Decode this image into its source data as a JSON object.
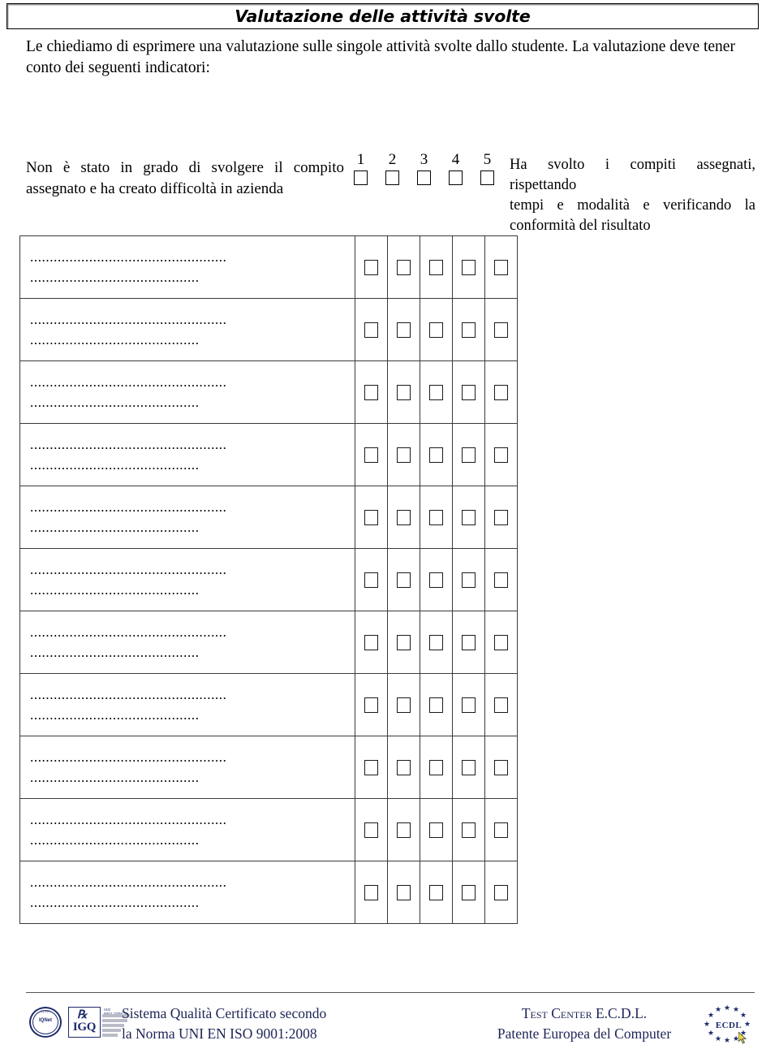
{
  "document": {
    "title": "Valutazione delle attività svolte",
    "intro_line1": "Le chiediamo di esprimere una valutazione sulle singole attività svolte dallo studente. La valutazione deve tener",
    "intro_line2": "conto dei seguenti indicatori:"
  },
  "legend": {
    "left_line1": "Non è stato in grado di svolgere il compito",
    "left_line2": "assegnato e ha creato difficoltà in azienda",
    "scale": [
      "1",
      "2",
      "3",
      "4",
      "5"
    ],
    "right_line1": "Ha svolto i compiti assegnati, rispettando",
    "right_line2": "tempi e modalità e verificando la",
    "right_line3": "conformità del risultato"
  },
  "table": {
    "dots_long": "..................................................",
    "dots_short": "...........................................",
    "rows": [
      {
        "line1": "..................................................",
        "line2": "..........................................."
      },
      {
        "line1": "..................................................",
        "line2": "..........................................."
      },
      {
        "line1": "..................................................",
        "line2": "..........................................."
      },
      {
        "line1": "..................................................",
        "line2": "..........................................."
      },
      {
        "line1": "..................................................",
        "line2": "..........................................."
      },
      {
        "line1": "..................................................",
        "line2": "..........................................."
      },
      {
        "line1": "..................................................",
        "line2": "..........................................."
      },
      {
        "line1": "..................................................",
        "line2": "..........................................."
      },
      {
        "line1": "..................................................",
        "line2": "..........................................."
      },
      {
        "line1": "..................................................",
        "line2": "..........................................."
      },
      {
        "line1": "..................................................",
        "line2": "..........................................."
      }
    ]
  },
  "footer": {
    "iqnet_label": "IQNet",
    "iqnet_arc": "IQNet",
    "igq_label": "IGQ",
    "iso_bars_label": "ISO 9001:2008",
    "left_line1": "Sistema Qualità Certificato secondo",
    "left_line2": "la Norma UNI EN ISO 9001:2008",
    "right_line1": "Test Center E.C.D.L.",
    "right_line2": "Patente Europea del Computer",
    "ecdl_label": "ECDL",
    "text_color": "#1d2456"
  }
}
